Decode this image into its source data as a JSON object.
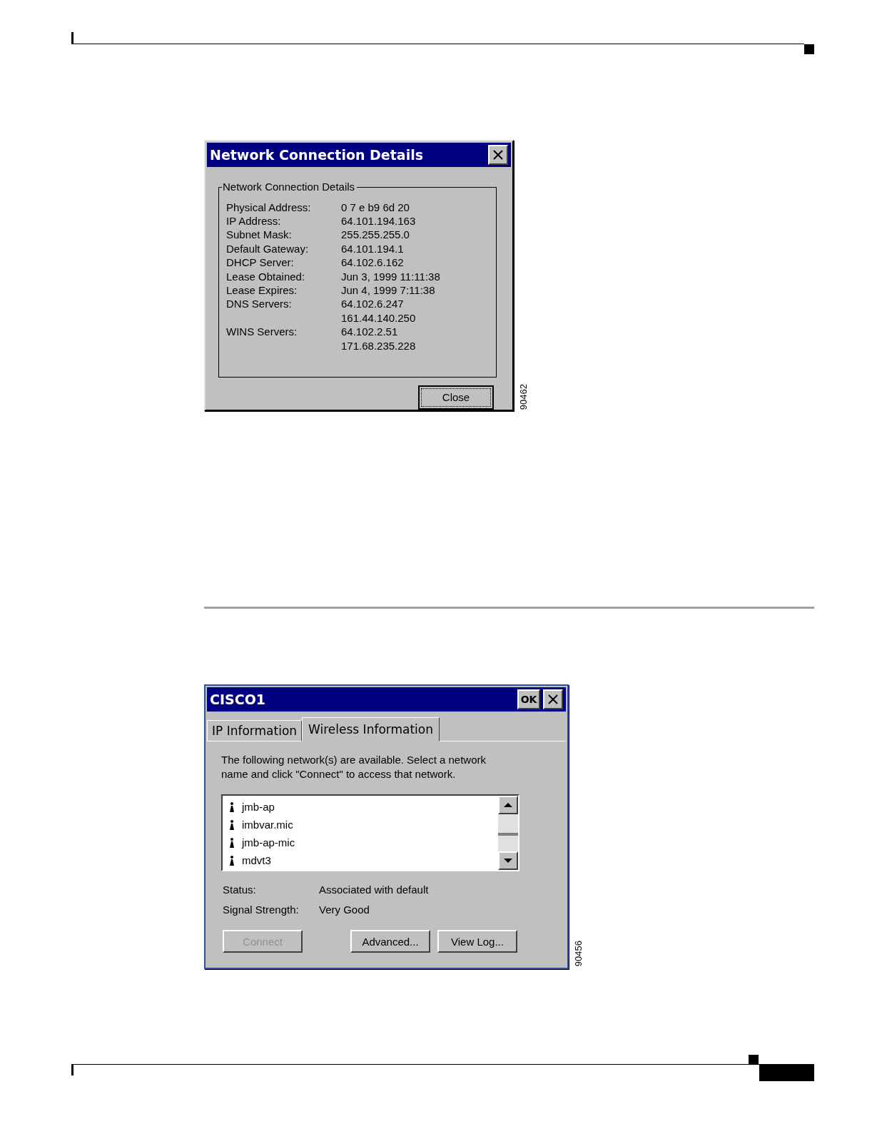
{
  "dialog_1": {
    "title": "Network Connection Details",
    "group_label": "Network Connection Details",
    "rows": [
      {
        "label": "Physical Address:",
        "values": [
          "0 7 e b9 6d 20"
        ]
      },
      {
        "label": "IP Address:",
        "values": [
          "64.101.194.163"
        ]
      },
      {
        "label": "Subnet Mask:",
        "values": [
          "255.255.255.0"
        ]
      },
      {
        "label": "Default Gateway:",
        "values": [
          "64.101.194.1"
        ]
      },
      {
        "label": "DHCP Server:",
        "values": [
          "64.102.6.162"
        ]
      },
      {
        "label": "Lease Obtained:",
        "values": [
          "Jun 3, 1999 11:11:38"
        ]
      },
      {
        "label": "Lease Expires:",
        "values": [
          "Jun 4, 1999 7:11:38"
        ]
      },
      {
        "label": "DNS Servers:",
        "values": [
          "64.102.6.247",
          "161.44.140.250"
        ]
      },
      {
        "label": "WINS Servers:",
        "values": [
          "64.102.2.51",
          "171.68.235.228"
        ]
      }
    ],
    "buttons": [
      {
        "label": "Close",
        "focused": true,
        "disabled": false
      }
    ],
    "figure_number": "90462"
  },
  "dialog_2": {
    "title": "CISCO1",
    "ok_label": "OK",
    "tabs": [
      {
        "label": "IP Information",
        "selected": false
      },
      {
        "label": "Wireless Information",
        "selected": true
      }
    ],
    "instructions": "The following network(s) are available. Select a network name and click \"Connect\" to access that network.",
    "networks": [
      {
        "name": "jmb-ap",
        "selected": false
      },
      {
        "name": "imbvar.mic",
        "selected": false
      },
      {
        "name": "jmb-ap-mic",
        "selected": false
      },
      {
        "name": "mdvt3",
        "selected": false
      }
    ],
    "status": [
      {
        "label": "Status:",
        "value": "Associated with default"
      },
      {
        "label": "Signal Strength:",
        "value": "Very Good"
      }
    ],
    "buttons": [
      {
        "label": "Connect",
        "disabled": true
      },
      {
        "label": "Advanced...",
        "disabled": false
      },
      {
        "label": "View Log...",
        "disabled": false
      }
    ],
    "figure_number": "90456"
  }
}
